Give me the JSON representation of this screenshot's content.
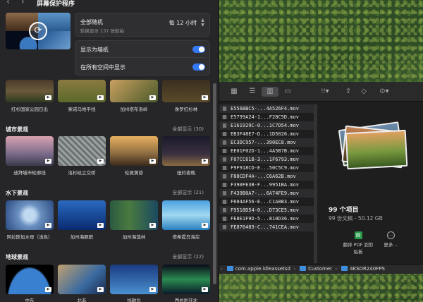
{
  "settings": {
    "title": "屏幕保护程序",
    "nav": {
      "back": "‹",
      "forward": "›"
    },
    "preview_icon": "shuffle-icon",
    "shuffle": {
      "title": "全部随机",
      "subtitle": "轮换显示 137 张航拍",
      "frequency": "每 12 小时"
    },
    "toggles": [
      {
        "label": "显示为墙纸",
        "on": true
      },
      {
        "label": "在所有空间中显示",
        "on": true
      }
    ],
    "partial_row": [
      {
        "caption": "红杉国家公园日出"
      },
      {
        "caption": "索诺马地平线"
      },
      {
        "caption": "加州塔布洛岭"
      },
      {
        "caption": "侏罗红杉林"
      }
    ],
    "sections": [
      {
        "title": "城市景观",
        "show_all": "全部显示 (30)",
        "items": [
          {
            "caption": "迪拜城市轮廓线"
          },
          {
            "caption": "洛杉矶立交桥"
          },
          {
            "caption": "伦敦黄昏"
          },
          {
            "caption": "纽约夜晚"
          }
        ]
      },
      {
        "title": "水下景观",
        "show_all": "全部显示 (21)",
        "items": [
          {
            "caption": "阿拉斯加水母（浅色）"
          },
          {
            "caption": "加州海豚群"
          },
          {
            "caption": "加州海藻林"
          },
          {
            "caption": "塔希提岛海岸"
          }
        ]
      },
      {
        "title": "地球景观",
        "show_all": "全部显示 (22)",
        "items": [
          {
            "caption": "中东"
          },
          {
            "caption": "北非"
          },
          {
            "caption": "加勒比"
          },
          {
            "caption": "西伯利亚北"
          }
        ]
      }
    ]
  },
  "finder": {
    "toolbar_icons": [
      "icon-view-icon",
      "list-view-icon",
      "column-view-icon",
      "gallery-view-icon",
      "group-icon",
      "share-icon",
      "tag-icon",
      "more-icon"
    ],
    "files": [
      "E556BBC5-...4A526F4.mov",
      "E5799A24-1...F28C5D.mov",
      "E161929C-0...1C7D54.mov",
      "EB3F48E7-D...1D5026.mov",
      "EC3DC957-...390EC8.mov",
      "EE01F02D-1...4A5B7B.mov",
      "F07CC61B-3...1F6793.mov",
      "F9F918CD-E...50C5C9.mov",
      "F88CDF4A-...C6A62B.mov",
      "F390FE3B-F...9951BA.mov",
      "F439B0A7-...6A74FE9.mov",
      "F604AF56-E...C1A8B3.mov",
      "F9518D54-0...D73CE5.mov",
      "FE8E1F9D-5...810D36.mov",
      "FE876489-C...741CEA.mov"
    ],
    "summary": {
      "count": "99 个项目",
      "size": "99 份文稿 - 50.12 GB"
    },
    "actions": [
      {
        "label": "翻译 PDF 到剪贴板",
        "icon": "pdf-icon"
      },
      {
        "label": "更多...",
        "icon": "more-circle-icon"
      }
    ],
    "path": [
      "com.apple.idleassetsd",
      "Customer",
      "4KSDR240FPS"
    ]
  }
}
